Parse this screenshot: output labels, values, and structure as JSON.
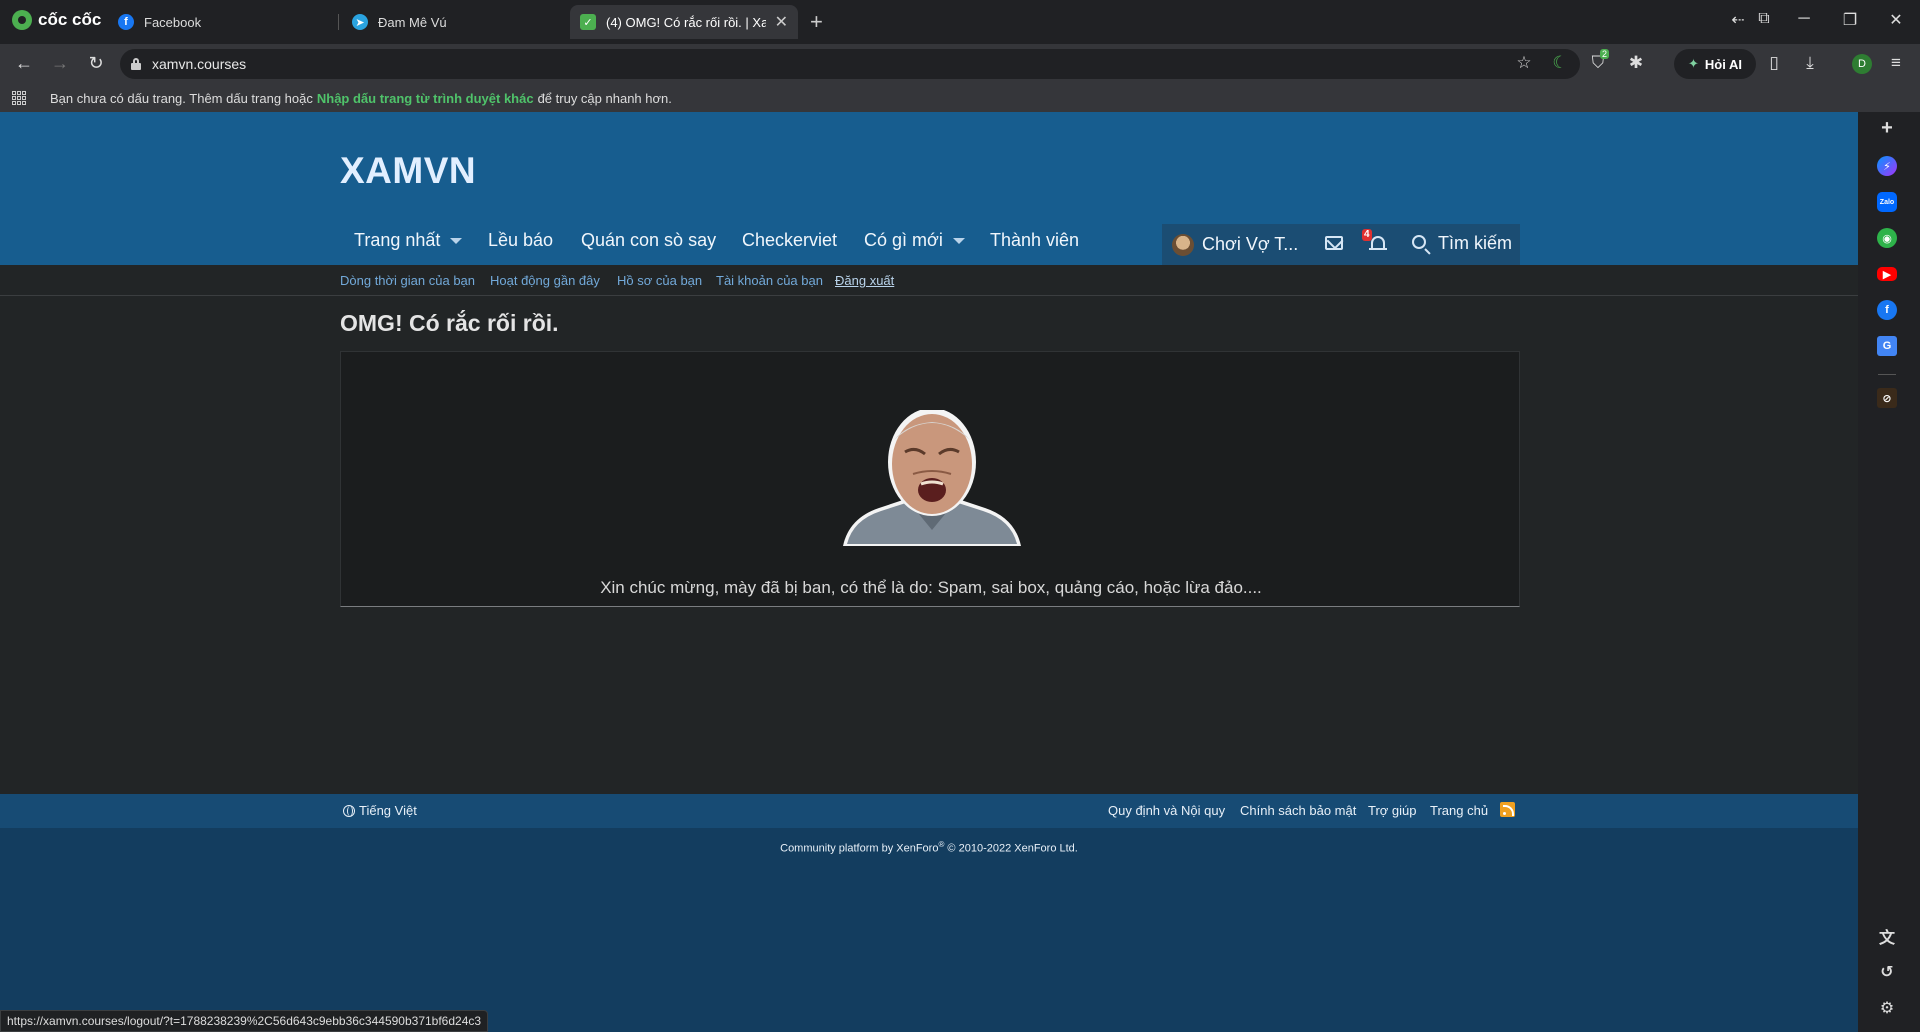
{
  "browser": {
    "brand": "cốc cốc",
    "tabs": [
      {
        "title": "Facebook"
      },
      {
        "title": "Đam Mê Vú"
      },
      {
        "title": "(4) OMG! Có rắc rối rồi. | Xa"
      }
    ],
    "url": "xamvn.courses",
    "hoi_ai_label": "Hỏi AI",
    "profile_initial": "D",
    "ext_badge": "2",
    "bookmark_bar": {
      "text_before": "Bạn chưa có dấu trang. Thêm dấu trang hoặc",
      "link": "Nhập dấu trang từ trình duyệt khác",
      "text_after": "để truy cập nhanh hơn."
    },
    "status_url": "https://xamvn.courses/logout/?t=1788238239%2C56d643c9ebb36c344590b371bf6d24c3"
  },
  "site": {
    "logo": "XAMVN",
    "nav": [
      {
        "label": "Trang nhất",
        "has_menu": true
      },
      {
        "label": "Lều báo",
        "has_menu": false
      },
      {
        "label": "Quán con sò say",
        "has_menu": false
      },
      {
        "label": "Checkerviet",
        "has_menu": false
      },
      {
        "label": "Có gì mới",
        "has_menu": true
      },
      {
        "label": "Thành viên",
        "has_menu": false
      }
    ],
    "user": {
      "name": "Chơi Vợ T...",
      "alerts_count": "4"
    },
    "search_label": "Tìm kiếm",
    "subnav": [
      "Dòng thời gian của bạn",
      "Hoạt động gần đây",
      "Hồ sơ của bạn",
      "Tài khoản của bạn",
      "Đăng xuất"
    ],
    "page_title": "OMG! Có rắc rối rồi.",
    "message": "Xin chúc mừng, mày đã bị ban, có thể là do: Spam, sai box, quảng cáo, hoặc lừa đảo....",
    "footer": {
      "language": "Tiếng Việt",
      "links": [
        "Quy định và Nội quy",
        "Chính sách bảo mật",
        "Trợ giúp",
        "Trang chủ"
      ],
      "copyright_prefix": "Community platform by XenForo",
      "copyright_sup": "®",
      "copyright_suffix": " © 2010-2022 XenForo Ltd."
    }
  },
  "colors": {
    "header": "#175d8f",
    "footer": "#133d5f",
    "link": "#72a9d9",
    "page_bg": "#222526"
  }
}
